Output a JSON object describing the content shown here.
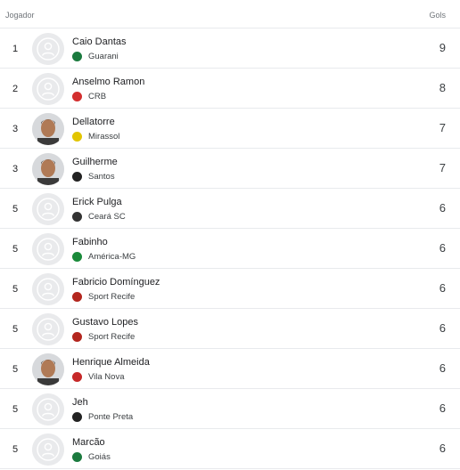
{
  "header": {
    "player_col": "Jogador",
    "goals_col": "Gols"
  },
  "rows": [
    {
      "rank": "1",
      "name": "Caio Dantas",
      "team": "Guarani",
      "goals": "9",
      "photo": false,
      "crest_color": "#1b7a3e",
      "crest_icon": "guarani-crest-icon"
    },
    {
      "rank": "2",
      "name": "Anselmo Ramon",
      "team": "CRB",
      "goals": "8",
      "photo": false,
      "crest_color": "#d32f2f",
      "crest_icon": "crb-crest-icon"
    },
    {
      "rank": "3",
      "name": "Dellatorre",
      "team": "Mirassol",
      "goals": "7",
      "photo": true,
      "crest_color": "#e2c500",
      "crest_icon": "mirassol-crest-icon"
    },
    {
      "rank": "3",
      "name": "Guilherme",
      "team": "Santos",
      "goals": "7",
      "photo": true,
      "crest_color": "#222222",
      "crest_icon": "santos-crest-icon"
    },
    {
      "rank": "5",
      "name": "Erick Pulga",
      "team": "Ceará SC",
      "goals": "6",
      "photo": false,
      "crest_color": "#333333",
      "crest_icon": "ceara-crest-icon"
    },
    {
      "rank": "5",
      "name": "Fabinho",
      "team": "América-MG",
      "goals": "6",
      "photo": false,
      "crest_color": "#1a8a3a",
      "crest_icon": "america-mg-crest-icon"
    },
    {
      "rank": "5",
      "name": "Fabricio Domínguez",
      "team": "Sport Recife",
      "goals": "6",
      "photo": false,
      "crest_color": "#b3261e",
      "crest_icon": "sport-recife-crest-icon"
    },
    {
      "rank": "5",
      "name": "Gustavo Lopes",
      "team": "Sport Recife",
      "goals": "6",
      "photo": false,
      "crest_color": "#b3261e",
      "crest_icon": "sport-recife-crest-icon"
    },
    {
      "rank": "5",
      "name": "Henrique Almeida",
      "team": "Vila Nova",
      "goals": "6",
      "photo": true,
      "crest_color": "#c62828",
      "crest_icon": "vila-nova-crest-icon"
    },
    {
      "rank": "5",
      "name": "Jeh",
      "team": "Ponte Preta",
      "goals": "6",
      "photo": false,
      "crest_color": "#222222",
      "crest_icon": "ponte-preta-crest-icon"
    },
    {
      "rank": "5",
      "name": "Marcão",
      "team": "Goiás",
      "goals": "6",
      "photo": false,
      "crest_color": "#1b7a3e",
      "crest_icon": "goias-crest-icon"
    }
  ]
}
